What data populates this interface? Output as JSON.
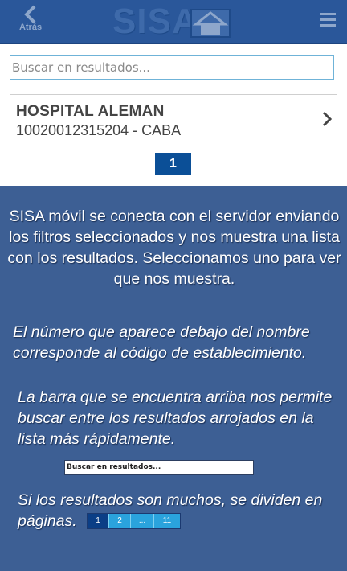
{
  "topbar": {
    "back_label": "Atrás",
    "logo_text": "SISA",
    "icons": {
      "back": "chevron-left-icon",
      "menu": "hamburger-menu-icon",
      "logo_house": "house-icon"
    },
    "color": "#2a579a"
  },
  "search": {
    "placeholder": "Buscar en resultados..."
  },
  "results": [
    {
      "name": "HOSPITAL ALEMAN",
      "subtitle": "10020012315204 - CABA"
    }
  ],
  "pagination": {
    "current": "1"
  },
  "info": {
    "paragraph1": "SISA móvil se conecta con el servidor enviando los filtros seleccionados y nos muestra una lista con los resultados. Seleccionamos uno para ver que nos muestra.",
    "paragraph2": "El número que aparece debajo del nombre corresponde al código de establecimiento.",
    "paragraph3": "La barra que se encuentra arriba nos permite buscar entre los resultados arrojados en la lista más rápidamente.",
    "example_search": "Buscar en resultados...",
    "paragraph4": "Si los resultados son muchos, se dividen en páginas.",
    "example_pages": [
      "1",
      "2",
      "...",
      "11"
    ]
  },
  "colors": {
    "background": "#3d5f94",
    "accent": "#0b4f97",
    "page_light": "#2aa3dd"
  }
}
